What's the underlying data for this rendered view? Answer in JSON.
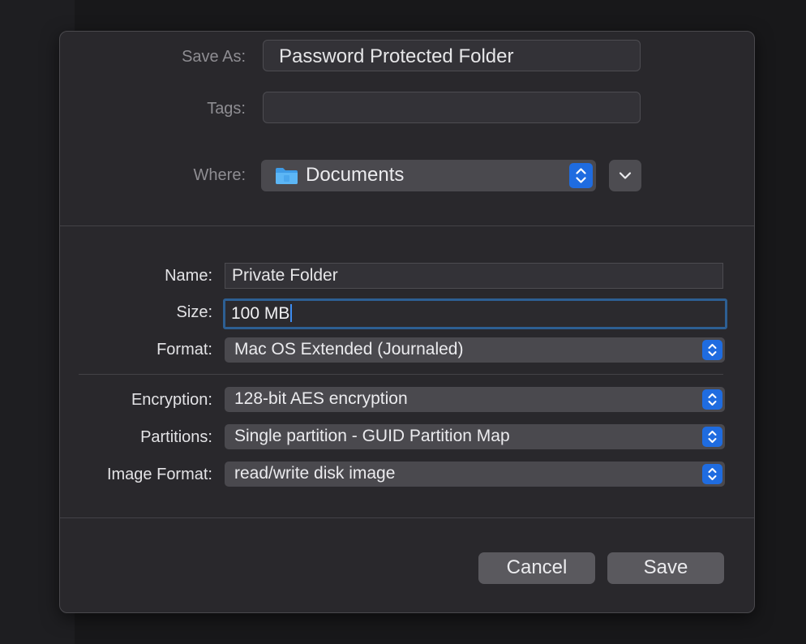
{
  "dialog": {
    "save_as_label": "Save As:",
    "save_as_value": "Password Protected Folder",
    "tags_label": "Tags:",
    "tags_value": "",
    "where_label": "Where:",
    "where_value": "Documents"
  },
  "image_options": {
    "name_label": "Name:",
    "name_value": "Private Folder",
    "size_label": "Size:",
    "size_value": "100 MB",
    "format_label": "Format:",
    "format_value": "Mac OS Extended (Journaled)",
    "encryption_label": "Encryption:",
    "encryption_value": "128-bit AES encryption",
    "partitions_label": "Partitions:",
    "partitions_value": "Single partition - GUID Partition Map",
    "image_format_label": "Image Format:",
    "image_format_value": "read/write disk image"
  },
  "buttons": {
    "cancel_label": "Cancel",
    "save_label": "Save"
  },
  "colors": {
    "accent": "#1f6ce0",
    "focus_ring": "#2d5f93",
    "sheet_background": "#29282c",
    "folder_icon": "#4aa8f0"
  },
  "icons": {
    "folder": "folder-icon",
    "stepper": "chevron-up-down-icon",
    "expand": "chevron-down-icon"
  }
}
